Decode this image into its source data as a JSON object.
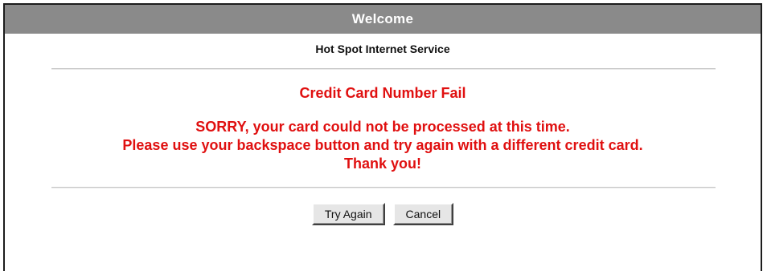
{
  "header": {
    "title": "Welcome"
  },
  "subtitle": "Hot Spot Internet Service",
  "error": {
    "title": "Credit Card Number Fail",
    "lines": [
      "SORRY, your card could not be processed at this time.",
      "Please use your backspace button and try again with a different credit card.",
      "Thank you!"
    ]
  },
  "buttons": {
    "try_again": "Try Again",
    "cancel": "Cancel"
  },
  "colors": {
    "header_bg": "#8a8a8a",
    "error_text": "#e01010"
  }
}
